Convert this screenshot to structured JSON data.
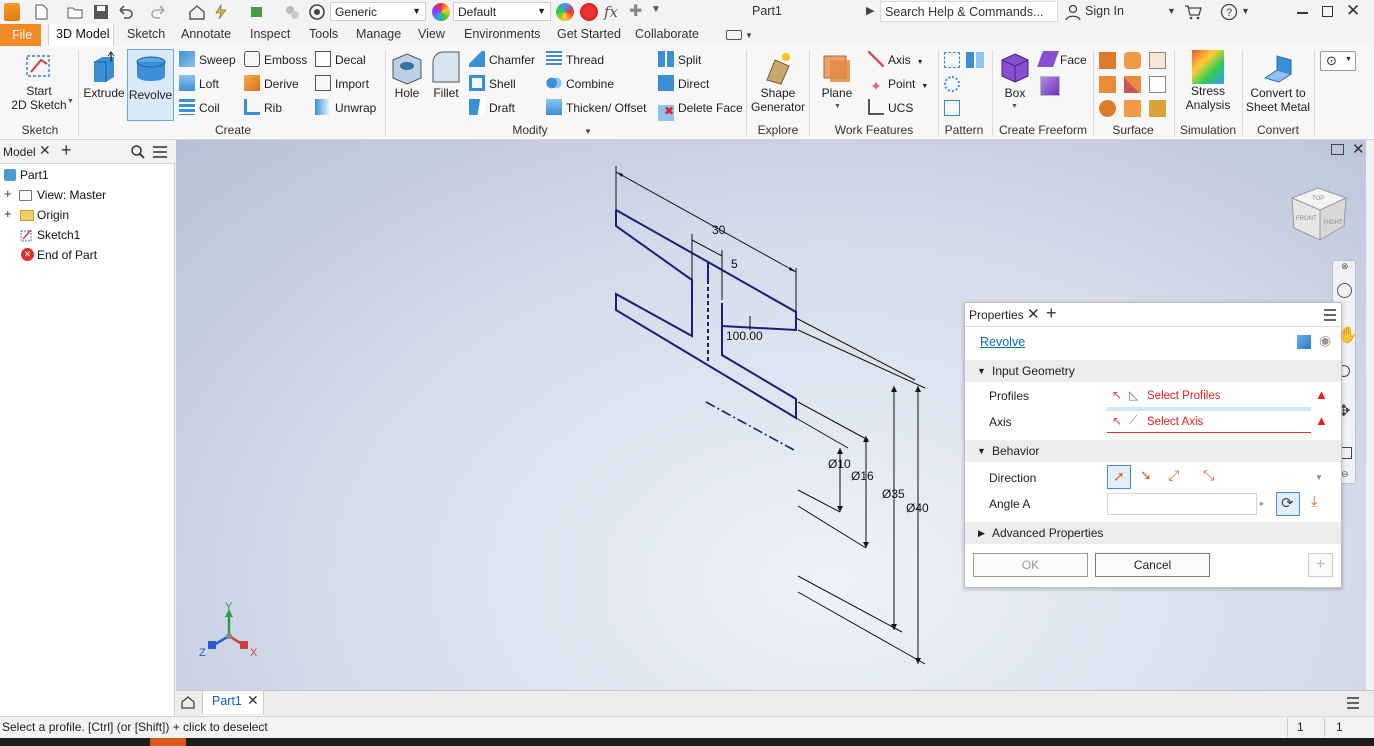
{
  "titlebar": {
    "material": "Generic",
    "appearance": "Default",
    "fx": "fx",
    "doc_title": "Part1",
    "search_placeholder": "Search Help & Commands...",
    "sign_in": "Sign In"
  },
  "ribbon_tabs": [
    "File",
    "3D Model",
    "Sketch",
    "Annotate",
    "Inspect",
    "Tools",
    "Manage",
    "View",
    "Environments",
    "Get Started",
    "Collaborate"
  ],
  "ribbon": {
    "sketch_group": {
      "start_sketch": "Start\n2D Sketch",
      "label": "Sketch"
    },
    "create_group": {
      "extrude": "Extrude",
      "revolve": "Revolve",
      "sweep": "Sweep",
      "loft": "Loft",
      "coil": "Coil",
      "emboss": "Emboss",
      "derive": "Derive",
      "rib": "Rib",
      "decal": "Decal",
      "import": "Import",
      "unwrap": "Unwrap",
      "label": "Create"
    },
    "modify_group": {
      "hole": "Hole",
      "fillet": "Fillet",
      "chamfer": "Chamfer",
      "shell": "Shell",
      "draft": "Draft",
      "thread": "Thread",
      "combine": "Combine",
      "thicken": "Thicken/ Offset",
      "split": "Split",
      "direct": "Direct",
      "delete_face": "Delete Face",
      "label": "Modify"
    },
    "explore_group": {
      "shape_generator": "Shape\nGenerator",
      "label": "Explore"
    },
    "work_features_group": {
      "plane": "Plane",
      "axis": "Axis",
      "point": "Point",
      "ucs": "UCS",
      "label": "Work Features"
    },
    "pattern_group": {
      "label": "Pattern"
    },
    "freeform_group": {
      "box": "Box",
      "face": "Face",
      "label": "Create Freeform"
    },
    "surface_group": {
      "label": "Surface"
    },
    "simulation_group": {
      "stress": "Stress\nAnalysis",
      "label": "Simulation"
    },
    "convert_group": {
      "convert": "Convert to\nSheet Metal",
      "label": "Convert"
    }
  },
  "browser": {
    "title": "Model",
    "items": [
      {
        "label": "Part1"
      },
      {
        "label": "View: Master"
      },
      {
        "label": "Origin"
      },
      {
        "label": "Sketch1"
      },
      {
        "label": "End of Part"
      }
    ]
  },
  "sketch": {
    "dims": {
      "d30": "30",
      "d5": "5",
      "d100": "100.00",
      "dia10": "Ø10",
      "dia16": "Ø16",
      "dia35": "Ø35",
      "dia40": "Ø40"
    },
    "viewcube": {
      "top": "TOP",
      "front": "FRONT",
      "right": "RIGHT"
    },
    "triad": {
      "x": "X",
      "y": "Y",
      "z": "Z"
    }
  },
  "properties": {
    "title": "Properties",
    "feature": "Revolve",
    "input_geometry": "Input Geometry",
    "profiles_label": "Profiles",
    "profiles_value": "Select Profiles",
    "axis_label": "Axis",
    "axis_value": "Select Axis",
    "behavior": "Behavior",
    "direction_label": "Direction",
    "angle_label": "Angle A",
    "angle_value": "",
    "advanced": "Advanced Properties",
    "ok": "OK",
    "cancel": "Cancel"
  },
  "docbar": {
    "tab": "Part1"
  },
  "status": {
    "message": "Select a profile. [Ctrl] (or [Shift]) + click to deselect",
    "n1": "1",
    "n2": "1"
  },
  "colors": {
    "accent": "#0696d7",
    "sketch_line": "#1a1f7a",
    "error": "#e02020",
    "file_tab": "#f08a24"
  }
}
